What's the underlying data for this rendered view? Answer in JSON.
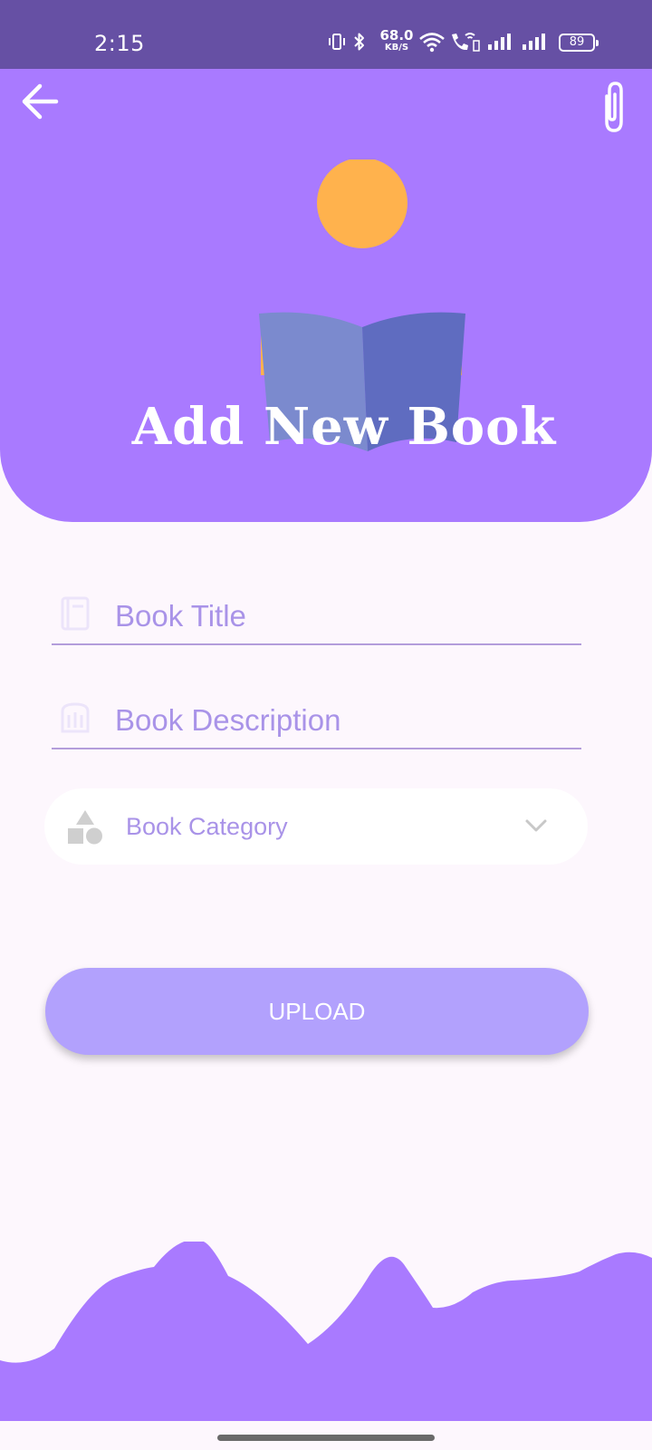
{
  "status_bar": {
    "time": "2:15",
    "network_speed": "68.0",
    "network_speed_unit": "KB/S",
    "battery_level": "89",
    "icons": [
      "vibrate-icon",
      "bluetooth-icon",
      "wifi-icon",
      "wifi-calling-icon",
      "signal-icon",
      "signal-icon",
      "battery-icon"
    ]
  },
  "header": {
    "back_icon": "arrow-back-icon",
    "attach_icon": "paperclip-icon",
    "illustration": "reading-person-icon",
    "title": "Add New Book"
  },
  "form": {
    "title_field": {
      "placeholder": "Book Title",
      "value": "",
      "icon": "book-icon"
    },
    "description_field": {
      "placeholder": "Book Description",
      "value": "",
      "icon": "description-icon"
    },
    "category_select": {
      "selected": "Book Category",
      "icon": "shapes-icon",
      "chevron": "chevron-down-icon"
    },
    "upload_label": "UPLOAD"
  },
  "colors": {
    "status_bar": "#6650a4",
    "primary": "#a97aff",
    "button": "#b2a1fd",
    "hint_text": "#a993e8",
    "background": "#fdf7fd"
  }
}
